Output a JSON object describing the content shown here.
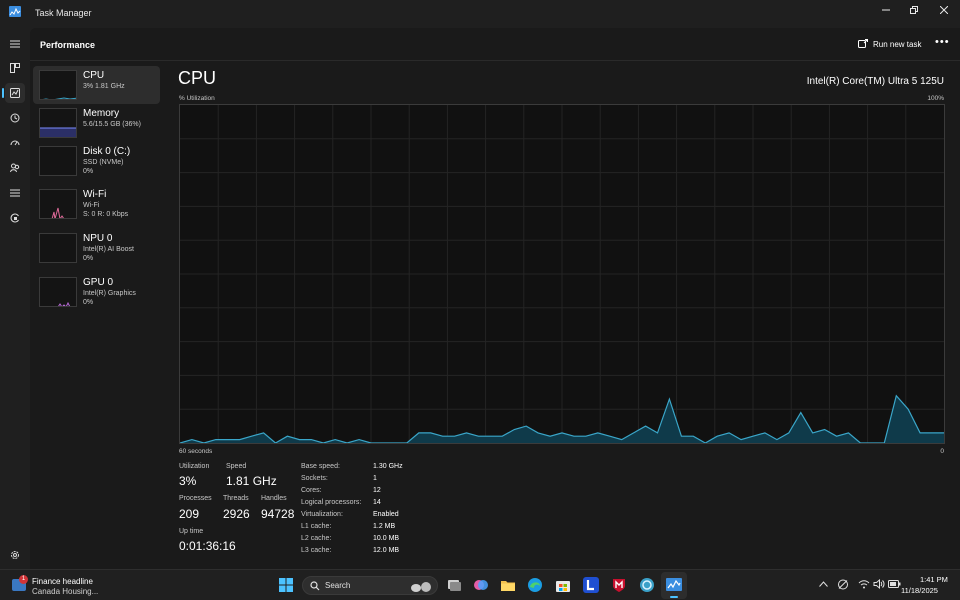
{
  "window": {
    "title": "Task Manager"
  },
  "header": {
    "title": "Performance",
    "run_task_label": "Run new task",
    "more_label": "•••"
  },
  "devices": [
    {
      "name": "CPU",
      "line1": "3% 1.81 GHz",
      "line2": ""
    },
    {
      "name": "Memory",
      "line1": "5.6/15.5 GB (36%)",
      "line2": ""
    },
    {
      "name": "Disk 0 (C:)",
      "line1": "SSD (NVMe)",
      "line2": "0%"
    },
    {
      "name": "Wi-Fi",
      "line1": "Wi-Fi",
      "line2": "S: 0 R: 0 Kbps"
    },
    {
      "name": "NPU 0",
      "line1": "Intel(R) AI Boost",
      "line2": "0%"
    },
    {
      "name": "GPU 0",
      "line1": "Intel(R) Graphics",
      "line2": "0%"
    }
  ],
  "cpu": {
    "title": "CPU",
    "model": "Intel(R) Core(TM) Ultra 5 125U",
    "y_axis_label": "% Utilization",
    "y_max_label": "100%",
    "x_left_label": "60 seconds",
    "x_right_label": "0",
    "utilization_series": [
      0,
      1,
      0,
      1,
      1,
      1,
      2,
      3,
      0,
      2,
      1,
      1,
      0,
      1,
      0,
      1,
      0,
      0,
      0,
      0,
      3,
      3,
      2,
      2,
      3,
      2,
      2,
      2,
      4,
      5,
      3,
      2,
      3,
      2,
      2,
      3,
      2,
      1,
      3,
      5,
      3,
      13,
      2,
      2,
      0,
      2,
      3,
      1,
      2,
      3,
      1,
      3,
      9,
      3,
      4,
      2,
      3,
      0,
      0,
      0,
      14,
      10,
      3,
      3,
      3
    ]
  },
  "stats": {
    "utilization_label": "Utilization",
    "utilization_value": "3%",
    "speed_label": "Speed",
    "speed_value": "1.81 GHz",
    "processes_label": "Processes",
    "processes_value": "209",
    "threads_label": "Threads",
    "threads_value": "2926",
    "handles_label": "Handles",
    "handles_value": "94728",
    "uptime_label": "Up time",
    "uptime_value": "0:01:36:16"
  },
  "specs": [
    {
      "label": "Base speed:",
      "value": "1.30 GHz"
    },
    {
      "label": "Sockets:",
      "value": "1"
    },
    {
      "label": "Cores:",
      "value": "12"
    },
    {
      "label": "Logical processors:",
      "value": "14"
    },
    {
      "label": "Virtualization:",
      "value": "Enabled"
    },
    {
      "label": "L1 cache:",
      "value": "1.2 MB"
    },
    {
      "label": "L2 cache:",
      "value": "10.0 MB"
    },
    {
      "label": "L3 cache:",
      "value": "12.0 MB"
    }
  ],
  "taskbar": {
    "news_badge": "1",
    "news_title": "Finance headline",
    "news_subtitle": "Canada Housing...",
    "search_label": "Search",
    "time": "1:41 PM",
    "date": "11/18/2025"
  },
  "colors": {
    "accent": "#4cc2ff",
    "cpu_line": "#3aa6c9",
    "cpu_fill": "#0f3a4a"
  }
}
